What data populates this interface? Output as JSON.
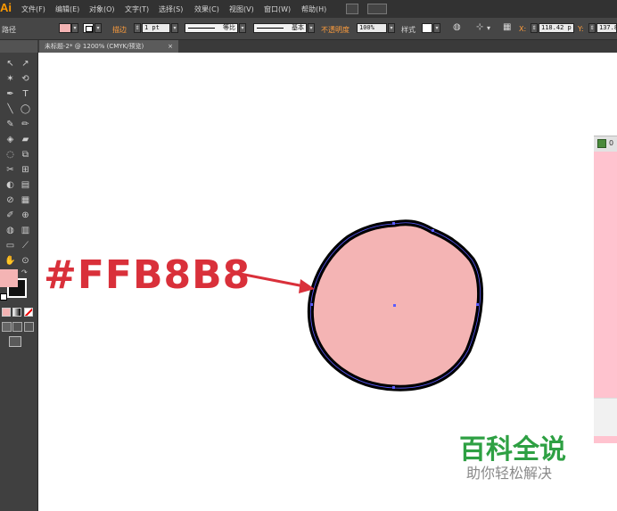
{
  "app": {
    "logo": "Ai"
  },
  "menu": [
    "文件(F)",
    "编辑(E)",
    "对象(O)",
    "文字(T)",
    "选择(S)",
    "效果(C)",
    "视图(V)",
    "窗口(W)",
    "帮助(H)"
  ],
  "control_bar": {
    "object_type": "路径",
    "fill_color": "#f4b4b4",
    "stroke_label": "描边",
    "stroke_weight": "1 pt",
    "profile_label": "等比",
    "brush_label": "基本",
    "opacity_label": "不透明度",
    "opacity_value": "100%",
    "style_label": "样式",
    "x_label": "X:",
    "x_value": "118.42 p",
    "y_label": "Y:",
    "y_value": "137.8"
  },
  "document_tab": {
    "title": "未标题-2* @ 1200% (CMYK/预览)",
    "close": "×"
  },
  "tools": [
    "↖",
    "↗",
    "✶",
    "⟲",
    "✒",
    "T",
    "╲",
    "◯",
    "✎",
    "✏",
    "◈",
    "▰",
    "◌",
    "⧉",
    "✂",
    "⊞",
    "◐",
    "▤",
    "⊘",
    "▦",
    "✐",
    "⊕",
    "◍",
    "▥",
    "▭",
    "⟋",
    "✋",
    "⊙"
  ],
  "swatches": {
    "fill": "#f4b4b4",
    "stroke": "#111111"
  },
  "artwork": {
    "fill_color": "#f4b4b4",
    "stroke_color": "#000000",
    "path_color": "#5b5bff"
  },
  "annotation": {
    "hex_text": "#FFB8B8",
    "arrow_color": "#d9303a"
  },
  "right_panel": {
    "number": "0",
    "color": "#ffc3cf"
  },
  "watermark": {
    "title": "百科全说",
    "subtitle": "助你轻松解决"
  }
}
